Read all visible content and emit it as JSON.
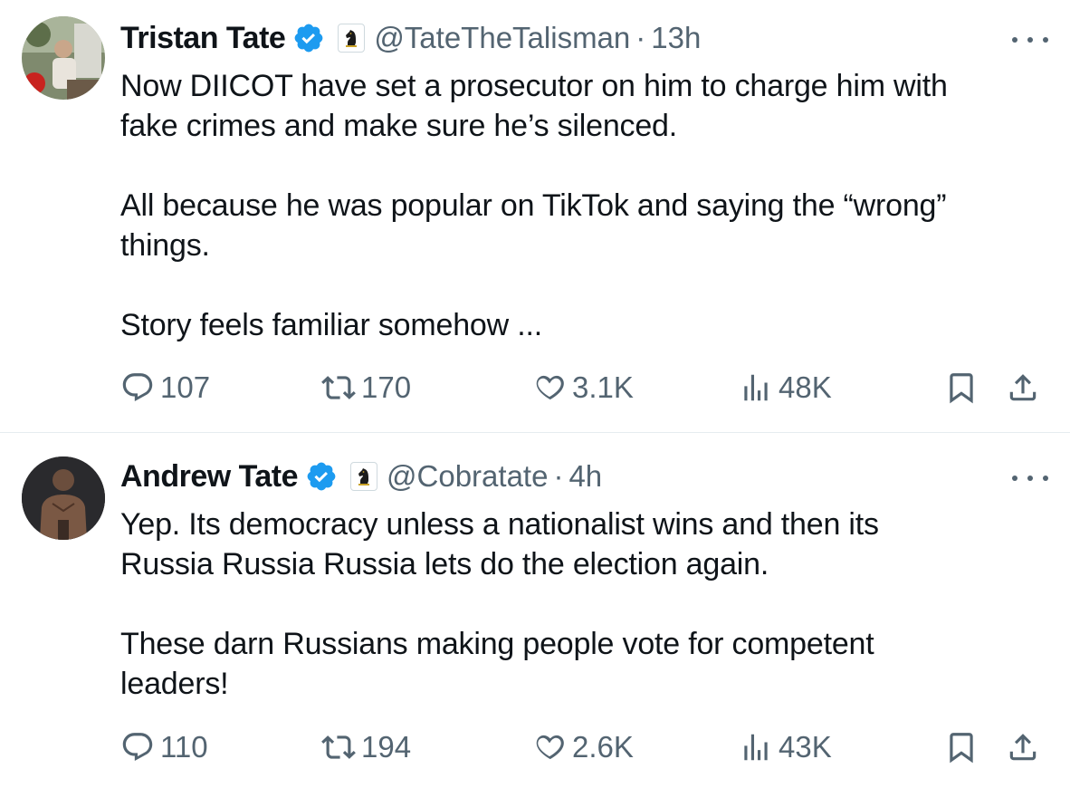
{
  "tweets": [
    {
      "name": "Tristan Tate",
      "handle": "@TateTheTalisman",
      "separator": "·",
      "time": "13h",
      "text_lines": [
        "Now DIICOT have set a prosecutor on him to charge him with",
        "fake crimes and make sure he’s silenced.",
        "",
        "All because he was popular on TikTok and saying the “wrong”",
        "things.",
        "",
        "Story feels familiar somehow ..."
      ],
      "replies": "107",
      "retweets": "170",
      "likes": "3.1K",
      "views": "48K"
    },
    {
      "name": "Andrew Tate",
      "handle": "@Cobratate",
      "separator": "·",
      "time": "4h",
      "text_lines": [
        "Yep. Its democracy unless a nationalist wins and then its",
        "Russia Russia Russia lets do the election again.",
        "",
        "These darn Russians making people vote for competent",
        "leaders!"
      ],
      "replies": "110",
      "retweets": "194",
      "likes": "2.6K",
      "views": "43K"
    }
  ],
  "icons": {
    "verified": "verified-badge-icon",
    "affiliate": "chess-knight-icon",
    "more": "more-icon",
    "reply": "reply-icon",
    "retweet": "retweet-icon",
    "like": "heart-icon",
    "views": "views-icon",
    "bookmark": "bookmark-icon",
    "share": "share-icon"
  },
  "colors": {
    "verified_blue": "#1d9bf0",
    "secondary_text": "#536471",
    "primary_text": "#0f1419",
    "affiliate_gold": "#c9a227"
  }
}
